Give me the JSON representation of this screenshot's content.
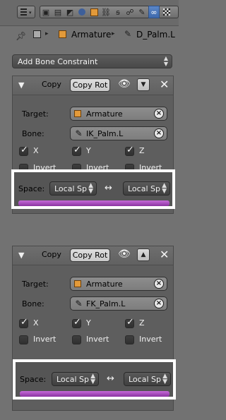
{
  "header": {
    "icons": [
      "editor-type-icon",
      "render-icon",
      "render-layers-icon",
      "scene-icon",
      "world-icon",
      "object-icon",
      "object-constraints-icon",
      "modifiers-icon",
      "bone-icon",
      "bone-constraints-icon",
      "texture-icon"
    ],
    "active_icon": "bone-constraints-icon"
  },
  "breadcrumb": {
    "object": "Armature",
    "bone": "D_Palm.L"
  },
  "add_constraint": {
    "label": "Add Bone Constraint"
  },
  "constraints": [
    {
      "type_label": "Copy",
      "name": "Copy Rot",
      "target_label": "Target:",
      "target": "Armature",
      "bone_label": "Bone:",
      "bone": "IK_Palm.L",
      "axes": [
        {
          "label": "X",
          "checked": true,
          "invert_label": "Invert",
          "invert": false
        },
        {
          "label": "Y",
          "checked": true,
          "invert_label": "Invert",
          "invert": false
        },
        {
          "label": "Z",
          "checked": true,
          "invert_label": "Invert",
          "invert": false
        }
      ],
      "space_label": "Space:",
      "owner_space": "Local Sp",
      "target_space": "Local Sp",
      "swap_symbol": "↔"
    },
    {
      "type_label": "Copy",
      "name": "Copy Rot",
      "target_label": "Target:",
      "target": "Armature",
      "bone_label": "Bone:",
      "bone": "FK_Palm.L",
      "axes": [
        {
          "label": "X",
          "checked": true,
          "invert_label": "Invert",
          "invert": false
        },
        {
          "label": "Y",
          "checked": true,
          "invert_label": "Invert",
          "invert": false
        },
        {
          "label": "Z",
          "checked": true,
          "invert_label": "Invert",
          "invert": false
        }
      ],
      "space_label": "Space:",
      "owner_space": "Local Sp",
      "target_space": "Local Sp",
      "swap_symbol": "↔"
    }
  ],
  "colors": {
    "highlight_box": "#ffffff",
    "influence_bar": "#b259c6",
    "active_tab": "#4a76bb"
  }
}
